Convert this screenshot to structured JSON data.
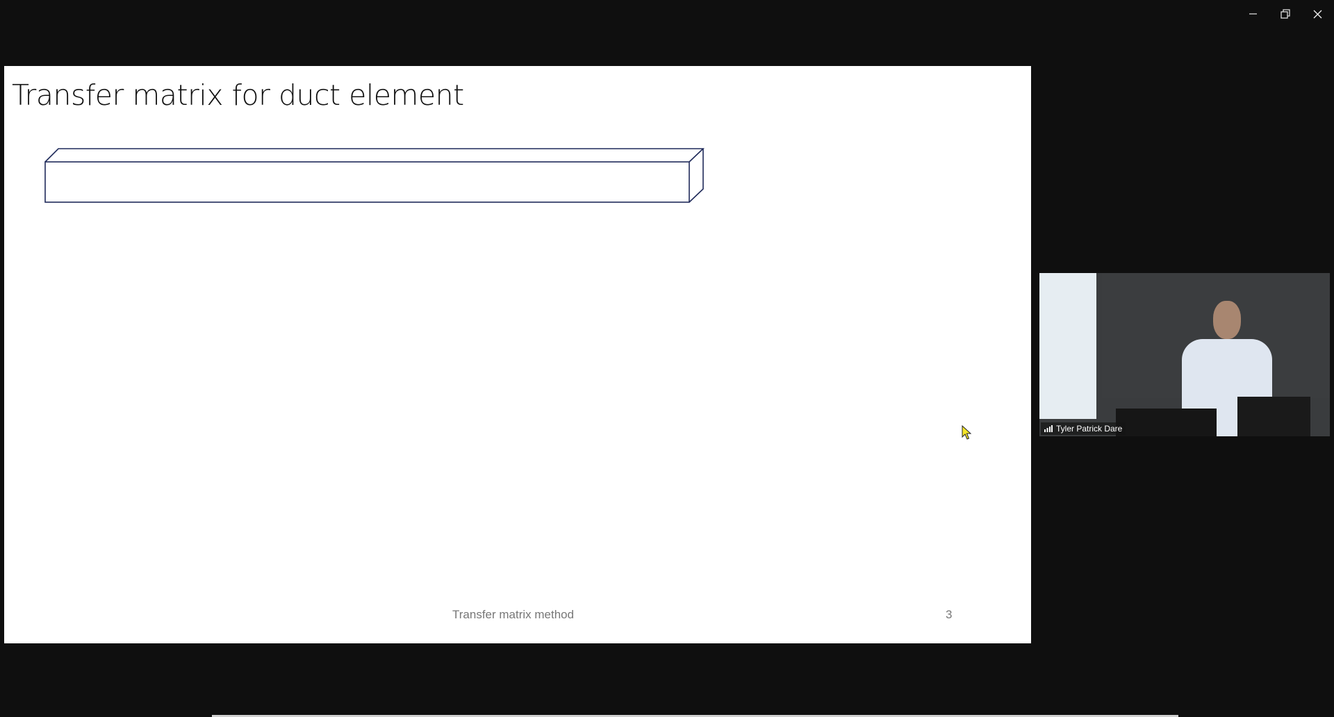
{
  "window_controls": {
    "minimize_icon": "minimize-icon",
    "restore_icon": "restore-icon",
    "close_icon": "close-icon"
  },
  "slide": {
    "title": "Transfer matrix for duct element",
    "footer": "Transfer matrix method",
    "page_number": "3",
    "diagram_color": "#1f2a5a"
  },
  "video": {
    "participant_name": "Tyler Patrick Dare",
    "signal_icon": "signal-bars-icon"
  }
}
